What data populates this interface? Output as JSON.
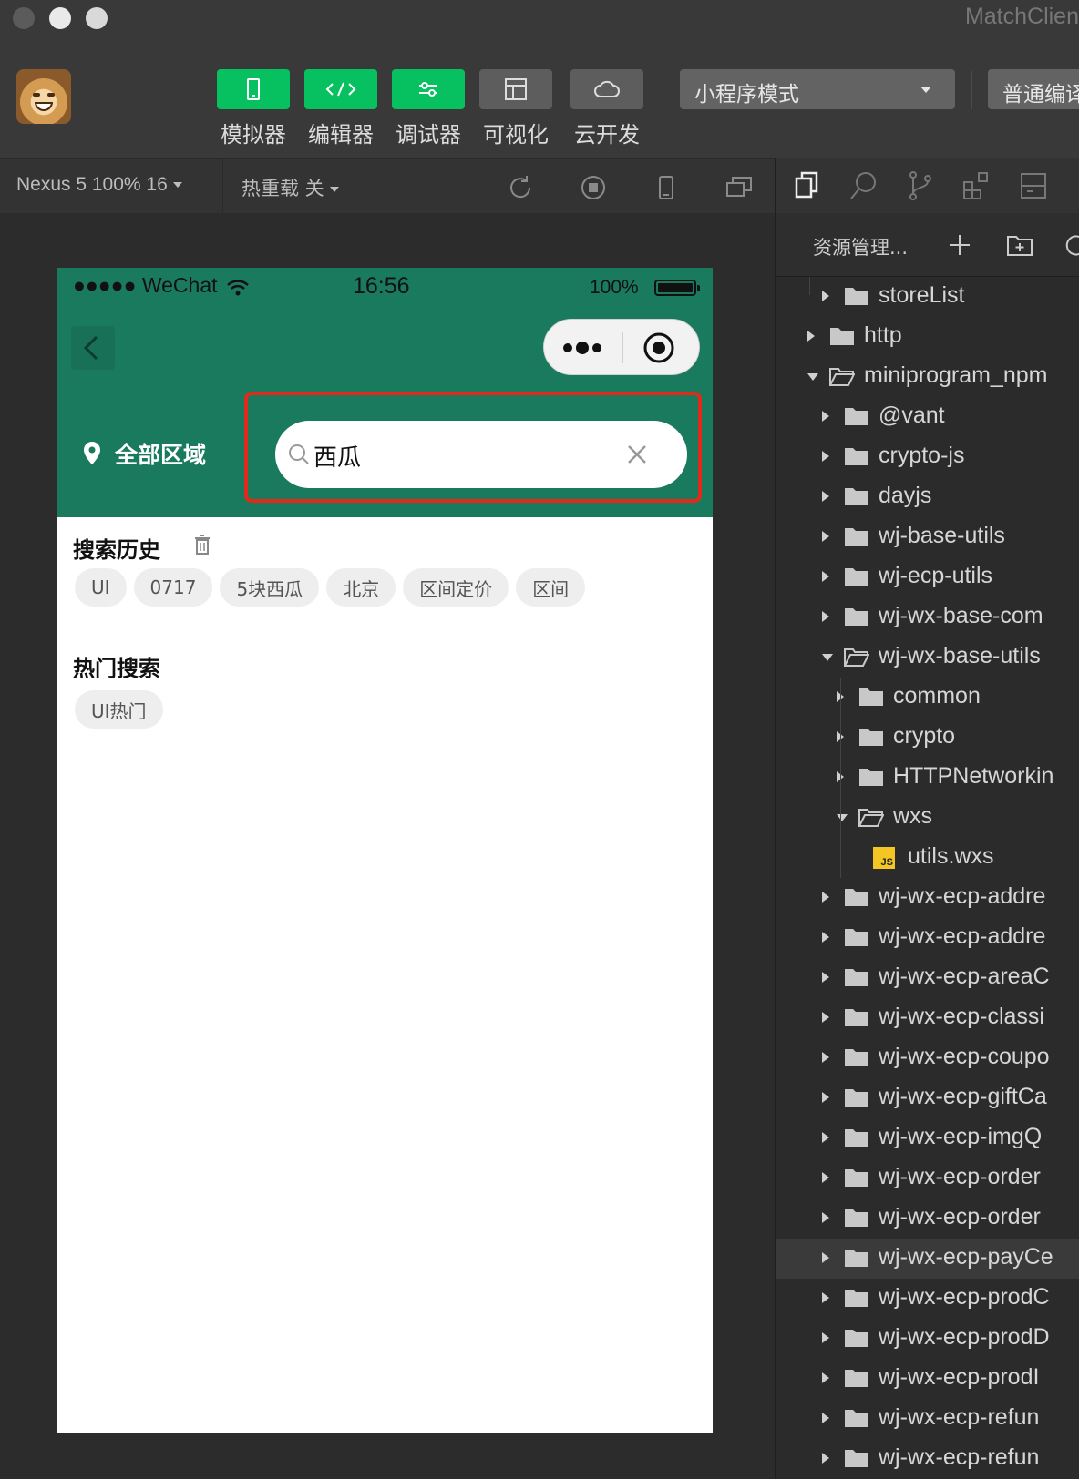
{
  "window": {
    "title": "MatchClien"
  },
  "toolbar": {
    "tools": [
      {
        "label": "模拟器",
        "icon": "phone-icon",
        "active": true
      },
      {
        "label": "编辑器",
        "icon": "code-icon",
        "active": true
      },
      {
        "label": "调试器",
        "icon": "sliders-icon",
        "active": true
      },
      {
        "label": "可视化",
        "icon": "layout-icon",
        "active": false
      },
      {
        "label": "云开发",
        "icon": "cloud-icon",
        "active": false
      }
    ],
    "mode_select": "小程序模式",
    "compile_select": "普通编译"
  },
  "simulator_bar": {
    "device": "Nexus 5 100% 16",
    "hot_reload": "热重载 关"
  },
  "phone": {
    "status": {
      "carrier": "●●●●● WeChat",
      "time": "16:56",
      "battery": "100%"
    },
    "region_label": "全部区域",
    "search_value": "西瓜",
    "history": {
      "title": "搜索历史",
      "chips": [
        "UI",
        "0717",
        "5块西瓜",
        "北京",
        "区间定价",
        "区间"
      ]
    },
    "hot": {
      "title": "热门搜索",
      "chips": [
        "UI热门"
      ]
    },
    "colors": {
      "header": "#1a7a5e",
      "highlight_border": "#e02a1a"
    }
  },
  "explorer": {
    "title": "资源管理...",
    "tree": [
      {
        "label": "storeList",
        "type": "folder",
        "expanded": false
      },
      {
        "label": "http",
        "type": "folder",
        "expanded": false
      },
      {
        "label": "miniprogram_npm",
        "type": "folder",
        "expanded": true
      },
      {
        "label": "@vant",
        "type": "folder",
        "expanded": false
      },
      {
        "label": "crypto-js",
        "type": "folder",
        "expanded": false
      },
      {
        "label": "dayjs",
        "type": "folder",
        "expanded": false
      },
      {
        "label": "wj-base-utils",
        "type": "folder",
        "expanded": false
      },
      {
        "label": "wj-ecp-utils",
        "type": "folder",
        "expanded": false
      },
      {
        "label": "wj-wx-base-com",
        "type": "folder",
        "expanded": false
      },
      {
        "label": "wj-wx-base-utils",
        "type": "folder",
        "expanded": true
      },
      {
        "label": "common",
        "type": "folder",
        "expanded": false
      },
      {
        "label": "crypto",
        "type": "folder",
        "expanded": false
      },
      {
        "label": "HTTPNetworkin",
        "type": "folder",
        "expanded": false
      },
      {
        "label": "wxs",
        "type": "folder",
        "expanded": true
      },
      {
        "label": "utils.wxs",
        "type": "file",
        "icon_text": "JS"
      },
      {
        "label": "wj-wx-ecp-addre",
        "type": "folder",
        "expanded": false
      },
      {
        "label": "wj-wx-ecp-addre",
        "type": "folder",
        "expanded": false
      },
      {
        "label": "wj-wx-ecp-areaC",
        "type": "folder",
        "expanded": false
      },
      {
        "label": "wj-wx-ecp-classi",
        "type": "folder",
        "expanded": false
      },
      {
        "label": "wj-wx-ecp-coupo",
        "type": "folder",
        "expanded": false
      },
      {
        "label": "wj-wx-ecp-giftCa",
        "type": "folder",
        "expanded": false
      },
      {
        "label": "wj-wx-ecp-imgQ",
        "type": "folder",
        "expanded": false
      },
      {
        "label": "wj-wx-ecp-order",
        "type": "folder",
        "expanded": false
      },
      {
        "label": "wj-wx-ecp-order",
        "type": "folder",
        "expanded": false
      },
      {
        "label": "wj-wx-ecp-payCe",
        "type": "folder",
        "expanded": false,
        "highlighted": true
      },
      {
        "label": "wj-wx-ecp-prodC",
        "type": "folder",
        "expanded": false
      },
      {
        "label": "wj-wx-ecp-prodD",
        "type": "folder",
        "expanded": false
      },
      {
        "label": "wj-wx-ecp-prodI",
        "type": "folder",
        "expanded": false
      },
      {
        "label": "wj-wx-ecp-refun",
        "type": "folder",
        "expanded": false
      },
      {
        "label": "wj-wx-ecp-refun",
        "type": "folder",
        "expanded": false
      }
    ]
  }
}
